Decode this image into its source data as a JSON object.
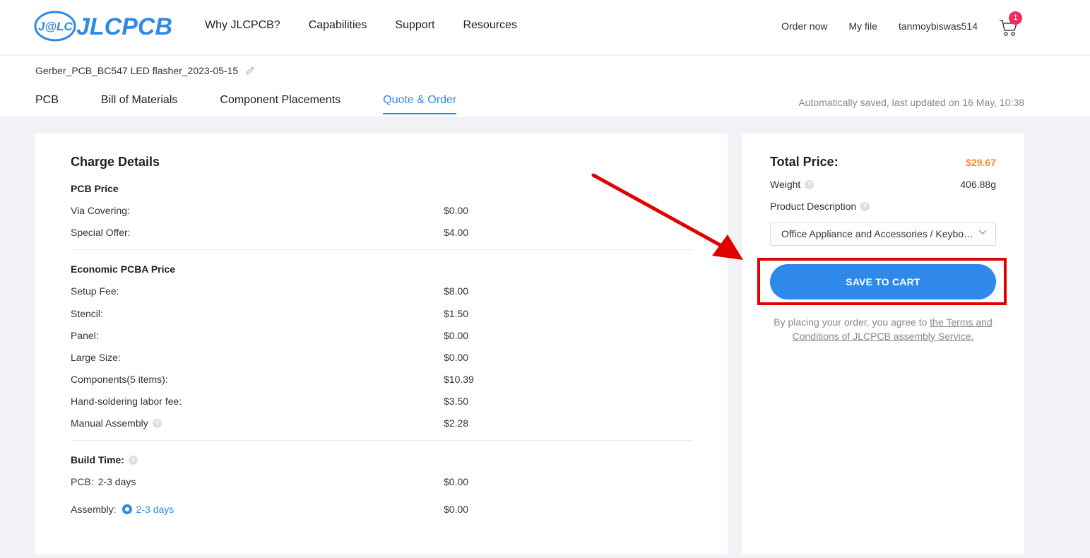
{
  "header": {
    "logo_text": "J@LC JLCPCB",
    "nav": [
      "Why JLCPCB?",
      "Capabilities",
      "Support",
      "Resources"
    ],
    "order_now": "Order now",
    "my_file": "My file",
    "username": "tanmoybiswas514",
    "cart_count": "1"
  },
  "subheader": {
    "filename": "Gerber_PCB_BC547 LED flasher_2023-05-15",
    "tabs": [
      "PCB",
      "Bill of Materials",
      "Component Placements",
      "Quote & Order"
    ],
    "active_tab": "Quote & Order",
    "autosave": "Automatically saved, last updated on 16 May, 10:38"
  },
  "charge_details": {
    "title": "Charge Details",
    "pcb_section": "PCB Price",
    "pcb_rows": [
      {
        "label": "Via Covering:",
        "value": "$0.00"
      },
      {
        "label": "Special Offer:",
        "value": "$4.00"
      }
    ],
    "pcba_section": "Economic PCBA Price",
    "pcba_rows": [
      {
        "label": "Setup Fee:",
        "value": "$8.00"
      },
      {
        "label": "Stencil:",
        "value": "$1.50"
      },
      {
        "label": "Panel:",
        "value": "$0.00"
      },
      {
        "label": "Large Size:",
        "value": "$0.00"
      },
      {
        "label": "Components(5 items):",
        "value": "$10.39"
      },
      {
        "label": "Hand-soldering labor fee:",
        "value": "$3.50"
      },
      {
        "label": "Manual Assembly",
        "value": "$2.28"
      }
    ],
    "build_time_section": "Build Time:",
    "pcb_build_label": "PCB:",
    "pcb_build_time": "2-3 days",
    "pcb_build_value": "$0.00",
    "assembly_label": "Assembly:",
    "assembly_time": "2-3 days",
    "assembly_value": "$0.00"
  },
  "summary": {
    "total_label": "Total Price:",
    "total_value": "$29.67",
    "weight_label": "Weight",
    "weight_value": "406.88g",
    "product_desc_label": "Product Description",
    "product_desc_value": "Office Appliance and Accessories / Keyboard",
    "save_button": "SAVE TO CART",
    "terms_prefix": "By placing your order, you agree to ",
    "terms_link": "the Terms and Conditions of JLCPCB assembly Service."
  },
  "colors": {
    "accent": "#2e89e8",
    "price": "#f08a3c",
    "highlight": "#e00000",
    "badge": "#e8305d"
  }
}
